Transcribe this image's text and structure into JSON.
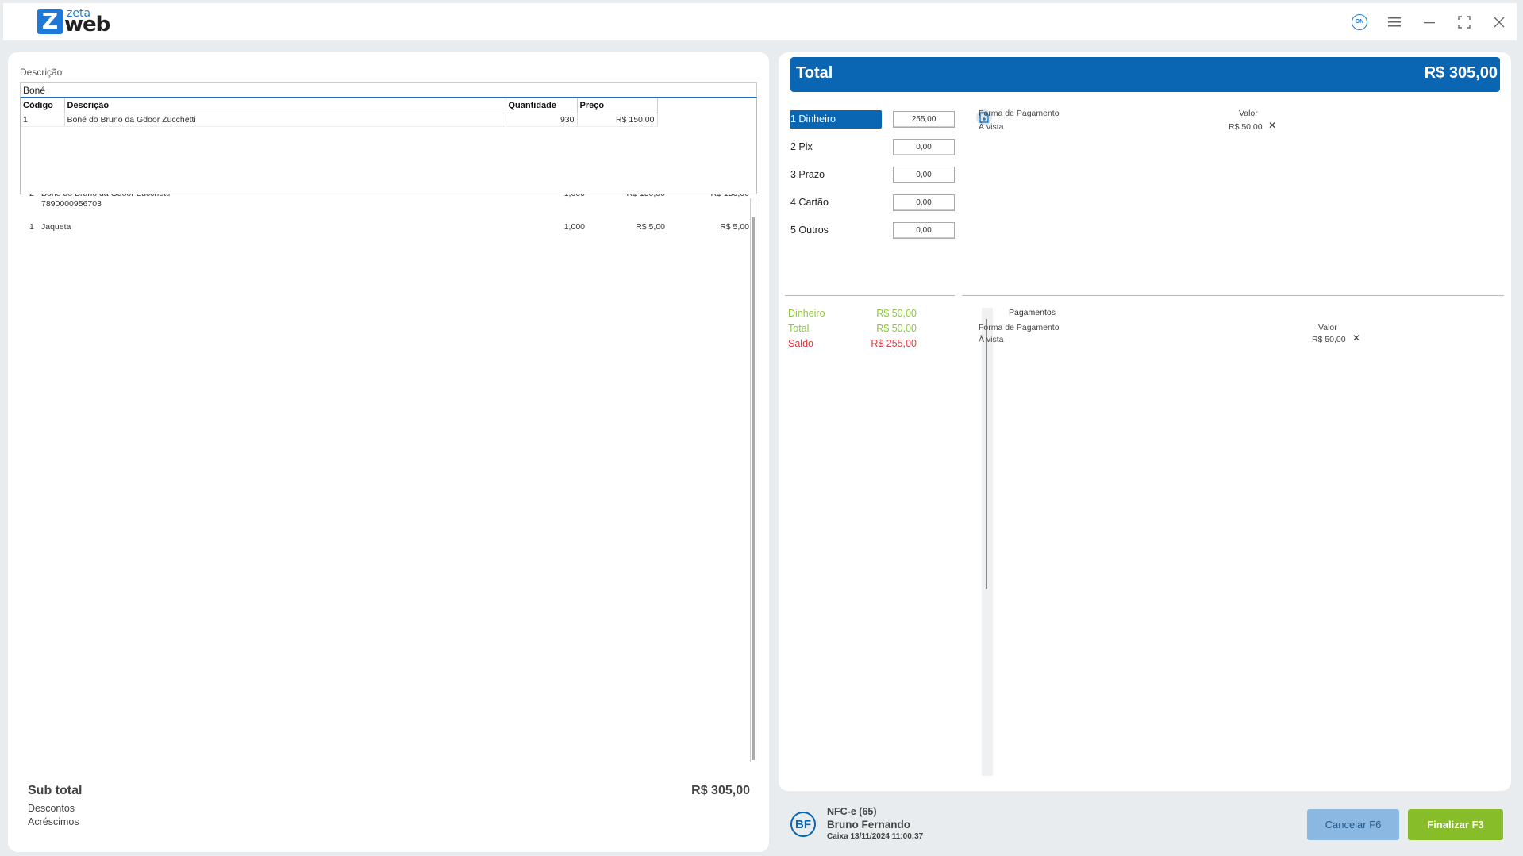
{
  "app": {
    "logo_top": "zeta",
    "logo_bottom": "web",
    "status_badge": "ON"
  },
  "left": {
    "desc_label": "Descrição",
    "desc_value": "Boné",
    "popup": {
      "headers": [
        "Código",
        "Descrição",
        "Quantidade",
        "Preço"
      ],
      "rows": [
        {
          "codigo": "1",
          "descricao": "Boné do Bruno da Gdoor Zucchetti",
          "quantidade": "930",
          "preco": "R$ 150,00"
        }
      ]
    },
    "items": [
      {
        "seq": "2",
        "name": "Boné do Bruno da Gdoor Zucchetti",
        "barcode": "7890000956703",
        "qty": "1,000",
        "price": "R$ 150,00",
        "total": "R$ 150,00"
      },
      {
        "seq": "1",
        "name": "Jaqueta",
        "barcode": "",
        "qty": "1,000",
        "price": "R$ 5,00",
        "total": "R$ 5,00"
      }
    ],
    "subtotal_label": "Sub total",
    "subtotal_value": "R$ 305,00",
    "descontos_label": "Descontos",
    "acrescimos_label": "Acréscimos"
  },
  "right": {
    "total_label": "Total",
    "total_value": "R$ 305,00",
    "methods": [
      {
        "label": "1 Dinheiro",
        "value": "255,00",
        "selected": true
      },
      {
        "label": "2 Pix",
        "value": "0,00",
        "selected": false
      },
      {
        "label": "3 Prazo",
        "value": "0,00",
        "selected": false
      },
      {
        "label": "4 Cartão",
        "value": "0,00",
        "selected": false
      },
      {
        "label": "5 Outros",
        "value": "0,00",
        "selected": false
      }
    ],
    "top_detail": {
      "col_forma": "Forma de Pagamento",
      "col_valor": "Valor",
      "row_forma": "À vista",
      "row_valor": "R$ 50,00"
    },
    "summary": [
      {
        "label": "Dinheiro",
        "value": "R$ 50,00",
        "color": "#8cc63f"
      },
      {
        "label": "Total",
        "value": "R$ 50,00",
        "color": "#8cc63f"
      },
      {
        "label": "Saldo",
        "value": "R$ 255,00",
        "color": "#e03a3e"
      }
    ],
    "pagamentos": {
      "title": "Pagamentos",
      "col_forma": "Forma de Pagamento",
      "col_valor": "Valor",
      "row_forma": "À vista",
      "row_valor": "R$ 50,00"
    }
  },
  "footer": {
    "avatar": "BF",
    "doc": "NFC-e (65)",
    "user": "Bruno Fernando",
    "caixa": "Caixa 13/11/2024 11:00:37",
    "cancel_label": "Cancelar F6",
    "final_label": "Finalizar F3"
  },
  "colors": {
    "primary": "#0a66b3",
    "finalize": "#87bd28",
    "cancel": "#8ab8e2",
    "saldo": "#e03a3e",
    "positive": "#8cc63f"
  }
}
